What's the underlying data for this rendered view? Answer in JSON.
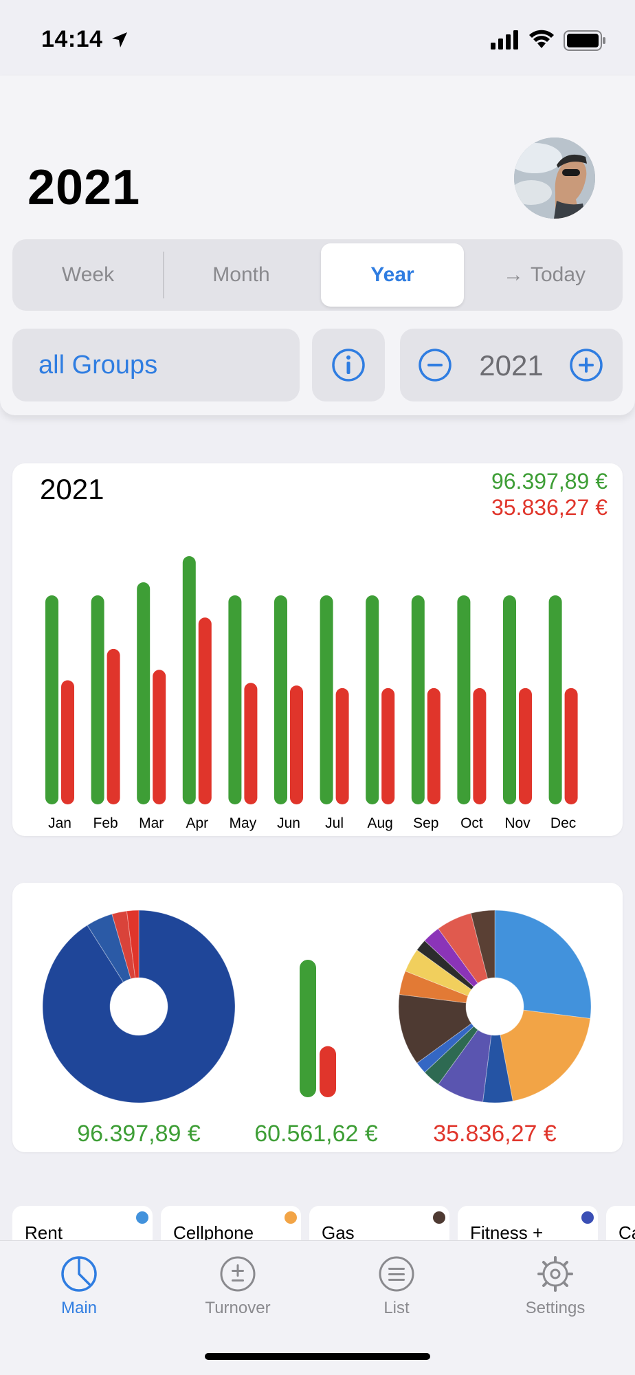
{
  "status_bar": {
    "time": "14:14"
  },
  "header": {
    "title": "2021"
  },
  "segments": {
    "week": "Week",
    "month": "Month",
    "year": "Year",
    "today_arrow": "→",
    "today": "Today",
    "selected": "Year"
  },
  "filters": {
    "groups_label": "all Groups",
    "year_value": "2021"
  },
  "colors": {
    "accent": "#2f7de1",
    "income": "#3e9e36",
    "expense": "#e0352b"
  },
  "bar_card": {
    "title": "2021",
    "total_income": "96.397,89 €",
    "total_expense": "35.836,27 €"
  },
  "chart_data": [
    {
      "type": "bar",
      "title": "2021",
      "categories": [
        "Jan",
        "Feb",
        "Mar",
        "Apr",
        "May",
        "Jun",
        "Jul",
        "Aug",
        "Sep",
        "Oct",
        "Nov",
        "Dec"
      ],
      "series": [
        {
          "values": [
            8000,
            8000,
            8500,
            9500,
            8000,
            8000,
            8000,
            8000,
            8000,
            8000,
            8000,
            8000
          ]
        },
        {
          "values": [
            4750,
            5950,
            5150,
            7150,
            4650,
            4550,
            4450,
            4450,
            4450,
            4450,
            4450,
            4450
          ]
        }
      ],
      "ylim": [
        0,
        10000
      ]
    },
    {
      "type": "pie",
      "slices": [
        {
          "value": 91.0,
          "color": "#1f4699"
        },
        {
          "value": 4.5,
          "color": "#2b5aa6"
        },
        {
          "value": 2.5,
          "color": "#d9433a"
        },
        {
          "value": 2.0,
          "color": "#e0352b"
        }
      ]
    },
    {
      "type": "bar",
      "categories": [
        "Balance"
      ],
      "series": [
        {
          "values": [
            96397.89
          ]
        },
        {
          "values": [
            35836.27
          ]
        }
      ]
    },
    {
      "type": "pie",
      "slices": [
        {
          "value": 27.0,
          "color": "#4292dc"
        },
        {
          "value": 20.0,
          "color": "#f2a446"
        },
        {
          "value": 5.0,
          "color": "#2554a4"
        },
        {
          "value": 8.0,
          "color": "#5a55b0"
        },
        {
          "value": 3.0,
          "color": "#2e6a52"
        },
        {
          "value": 2.0,
          "color": "#3467c4"
        },
        {
          "value": 12.0,
          "color": "#4e3a32"
        },
        {
          "value": 4.0,
          "color": "#e27a35"
        },
        {
          "value": 4.0,
          "color": "#f1cf5d"
        },
        {
          "value": 2.0,
          "color": "#2c2c2c"
        },
        {
          "value": 3.0,
          "color": "#8b34b8"
        },
        {
          "value": 6.0,
          "color": "#e05a4e"
        },
        {
          "value": 4.0,
          "color": "#5a4034"
        }
      ]
    }
  ],
  "summary": {
    "income": "96.397,89 €",
    "balance": "60.561,62 €",
    "expense": "35.836,27 €"
  },
  "chips": [
    {
      "label": "Rent",
      "color": "#4292dc"
    },
    {
      "label": "Cellphone",
      "color": "#f2a446"
    },
    {
      "label": "Gas",
      "color": "#4e3a32"
    },
    {
      "label": "Fitness +",
      "color": "#3b4fb5"
    },
    {
      "label": "Ca",
      "color": "#cccccc"
    }
  ],
  "tabs": [
    {
      "label": "Main",
      "icon": "pie-chart-icon"
    },
    {
      "label": "Turnover",
      "icon": "plus-minus-icon"
    },
    {
      "label": "List",
      "icon": "list-icon"
    },
    {
      "label": "Settings",
      "icon": "gear-icon"
    }
  ]
}
